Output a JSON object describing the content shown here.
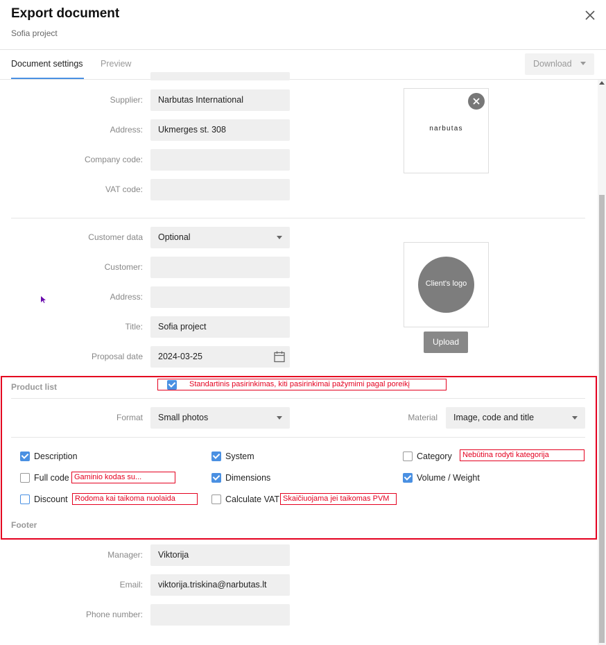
{
  "header": {
    "title": "Export document",
    "subtitle": "Sofia project"
  },
  "tabs": [
    {
      "label": "Document settings"
    },
    {
      "label": "Preview"
    }
  ],
  "download": {
    "label": "Download"
  },
  "supplier": {
    "supplier_label": "Supplier:",
    "supplier_value": "Narbutas International",
    "address_label": "Address:",
    "address_value": "Ukmerges st. 308",
    "company_code_label": "Company code:",
    "company_code_value": "",
    "vat_code_label": "VAT code:",
    "vat_code_value": "",
    "logo_text": "narbutas"
  },
  "customer": {
    "customer_data_label": "Customer data",
    "customer_data_value": "Optional",
    "customer_label": "Customer:",
    "customer_value": "",
    "address_label": "Address:",
    "address_value": "",
    "title_label": "Title:",
    "title_value": "Sofia project",
    "proposal_date_label": "Proposal date",
    "proposal_date_value": "2024-03-25",
    "client_logo_text": "Client's logo",
    "upload_label": "Upload"
  },
  "product_list": {
    "header": "Product list",
    "format_label": "Format",
    "format_value": "Small photos",
    "material_label": "Material",
    "material_value": "Image, code and title",
    "checkboxes": {
      "description": {
        "label": "Description",
        "checked": true
      },
      "system": {
        "label": "System",
        "checked": true
      },
      "category": {
        "label": "Category",
        "checked": false
      },
      "full_code": {
        "label": "Full code",
        "checked": false
      },
      "dimensions": {
        "label": "Dimensions",
        "checked": true
      },
      "volume_weight": {
        "label": "Volume / Weight",
        "checked": true
      },
      "discount": {
        "label": "Discount",
        "checked": false
      },
      "calculate_vat": {
        "label": "Calculate VAT",
        "checked": false
      }
    }
  },
  "annotations": {
    "default_selection": "Standartinis pasirinkimas, kiti pasirinkimai pažymimi pagal poreikį",
    "category": "Nebūtina rodyti kategorija",
    "full_code": "Gaminio kodas su...",
    "discount": "Rodoma kai taikoma nuolaida",
    "vat": "Skaičiuojama jei taikomas PVM"
  },
  "footer": {
    "header": "Footer",
    "manager_label": "Manager:",
    "manager_value": "Viktorija",
    "email_label": "Email:",
    "email_value": "viktorija.triskina@narbutas.lt",
    "phone_label": "Phone number:",
    "phone_value": ""
  },
  "colors": {
    "accent": "#4a90e2",
    "annotation": "#e4001f"
  }
}
